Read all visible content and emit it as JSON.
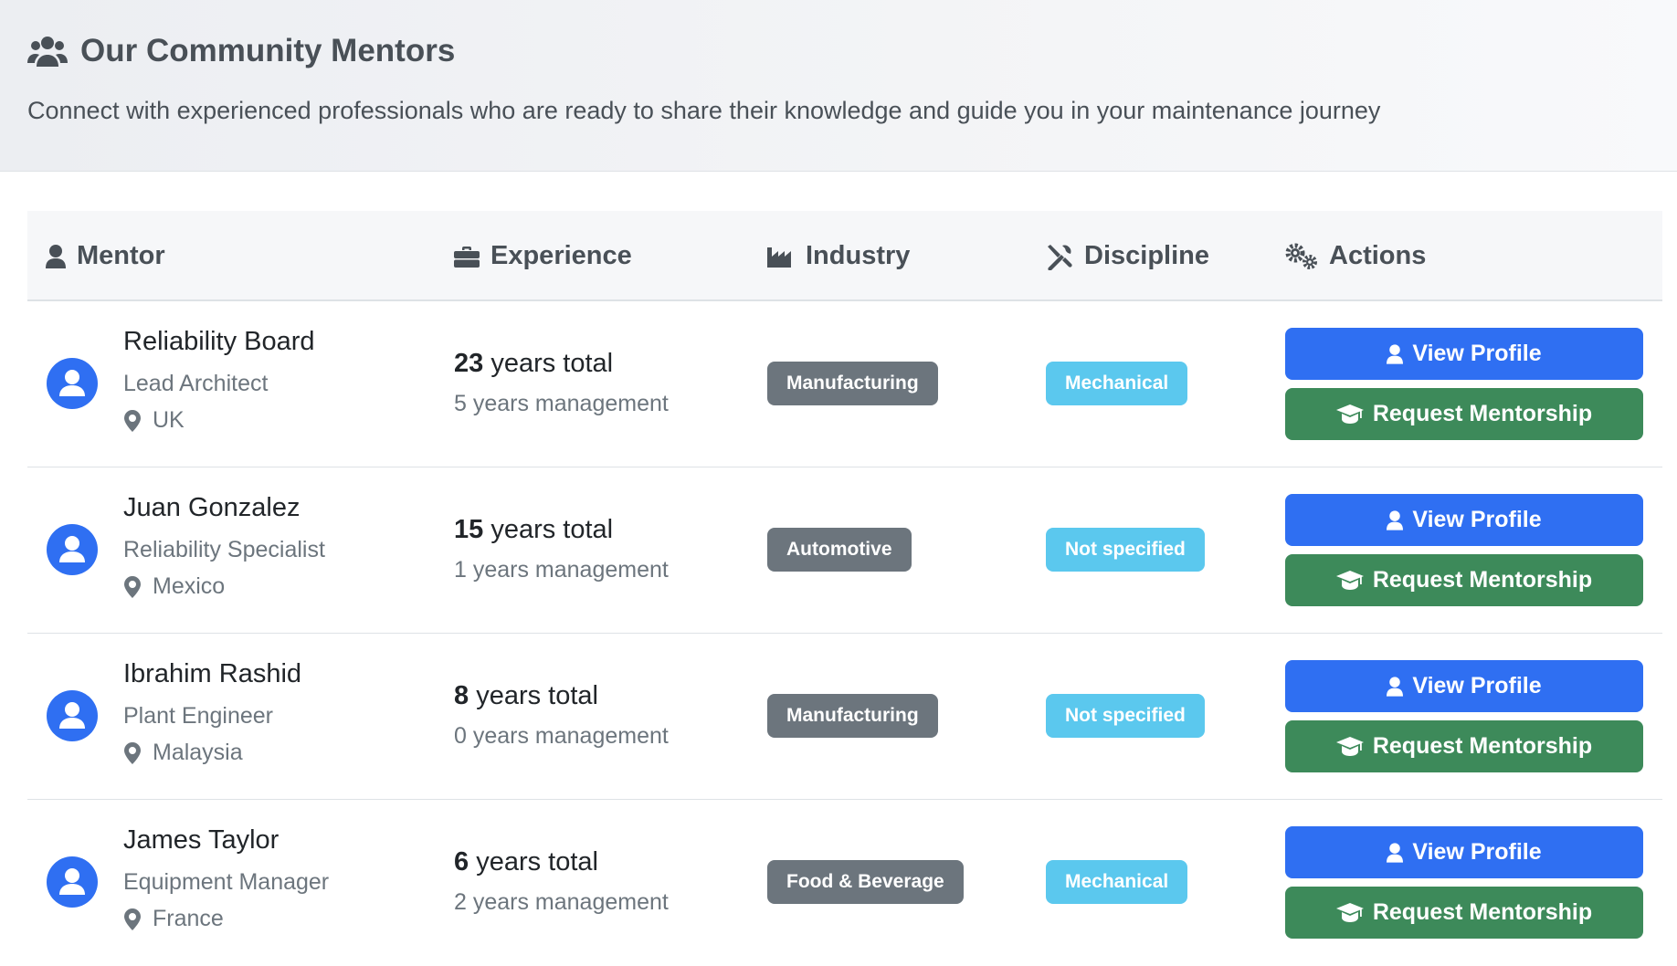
{
  "header": {
    "title": "Our Community Mentors",
    "subtitle": "Connect with experienced professionals who are ready to share their knowledge and guide you in your maintenance journey",
    "icon": "users-icon"
  },
  "table": {
    "columns": [
      {
        "label": "Mentor",
        "icon": "user-icon"
      },
      {
        "label": "Experience",
        "icon": "briefcase-icon"
      },
      {
        "label": "Industry",
        "icon": "industry-icon"
      },
      {
        "label": "Discipline",
        "icon": "tools-icon"
      },
      {
        "label": "Actions",
        "icon": "cogs-icon"
      }
    ],
    "rows": [
      {
        "name": "Reliability Board",
        "role": "Lead Architect",
        "location": "UK",
        "years_total": "23",
        "years_total_suffix": " years total",
        "years_management": "5 years management",
        "industry": "Manufacturing",
        "discipline": "Mechanical",
        "view_label": "View Profile",
        "request_label": "Request Mentorship"
      },
      {
        "name": "Juan Gonzalez",
        "role": "Reliability Specialist",
        "location": "Mexico",
        "years_total": "15",
        "years_total_suffix": " years total",
        "years_management": "1 years management",
        "industry": "Automotive",
        "discipline": "Not specified",
        "view_label": "View Profile",
        "request_label": "Request Mentorship"
      },
      {
        "name": "Ibrahim Rashid",
        "role": "Plant Engineer",
        "location": "Malaysia",
        "years_total": "8",
        "years_total_suffix": " years total",
        "years_management": "0 years management",
        "industry": "Manufacturing",
        "discipline": "Not specified",
        "view_label": "View Profile",
        "request_label": "Request Mentorship"
      },
      {
        "name": "James Taylor",
        "role": "Equipment Manager",
        "location": "France",
        "years_total": "6",
        "years_total_suffix": " years total",
        "years_management": "2 years management",
        "industry": "Food & Beverage",
        "discipline": "Mechanical",
        "view_label": "View Profile",
        "request_label": "Request Mentorship"
      }
    ]
  },
  "colors": {
    "primary": "#2f6ff2",
    "success": "#3d8a5a",
    "secondary_badge": "#6c757d",
    "info_badge": "#5bc8ee"
  }
}
